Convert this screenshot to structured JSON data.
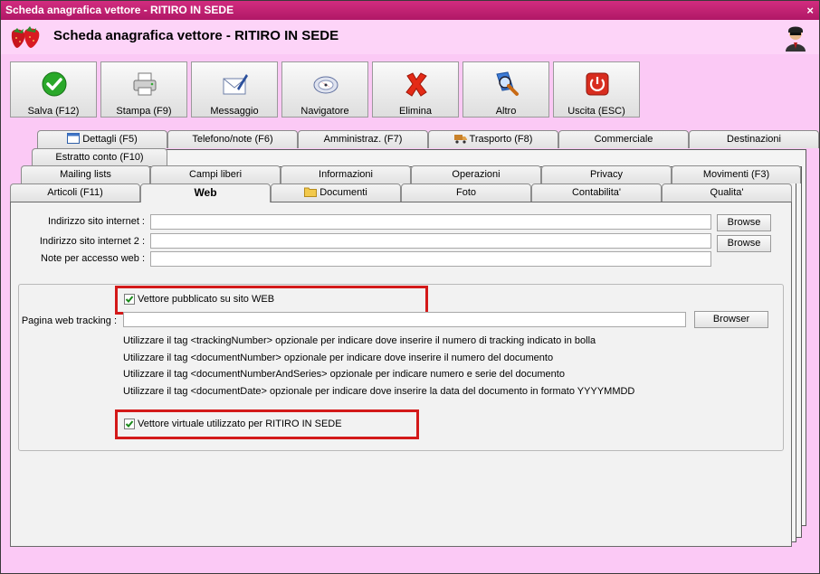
{
  "window": {
    "title": "Scheda anagrafica vettore - RITIRO IN SEDE",
    "close_glyph": "×"
  },
  "header": {
    "title": "Scheda anagrafica vettore - RITIRO IN SEDE",
    "logo_icon": "strawberry-icon",
    "user_icon": "user-agent-icon"
  },
  "toolbar": {
    "buttons": [
      {
        "label": "Salva (F12)",
        "icon": "checkmark-icon"
      },
      {
        "label": "Stampa (F9)",
        "icon": "printer-icon"
      },
      {
        "label": "Messaggio",
        "icon": "envelope-icon"
      },
      {
        "label": "Navigatore",
        "icon": "compass-icon"
      },
      {
        "label": "Elimina",
        "icon": "delete-x-icon"
      },
      {
        "label": "Altro",
        "icon": "search-document-icon"
      },
      {
        "label": "Uscita (ESC)",
        "icon": "power-icon"
      }
    ]
  },
  "tabs": {
    "row1": [
      "Dettagli (F5)",
      "Telefono/note (F6)",
      "Amministraz. (F7)",
      "Trasporto (F8)",
      "Commerciale",
      "Destinazioni"
    ],
    "row2": [
      "Estratto conto (F10)"
    ],
    "row3": [
      "Mailing lists",
      "Campi liberi",
      "Informazioni",
      "Operazioni",
      "Privacy",
      "Movimenti (F3)"
    ],
    "row4": [
      "Articoli (F11)",
      "Web",
      "Documenti",
      "Foto",
      "Contabilita'",
      "Qualita'"
    ],
    "active": "Web"
  },
  "web": {
    "sito_label": "Indirizzo sito internet :",
    "sito_value": "",
    "sito2_label": "Indirizzo sito internet 2 :",
    "sito2_value": "",
    "note_label": "Note per accesso web :",
    "note_value": "",
    "browse_label": "Browse",
    "pubblicato_label": "Vettore pubblicato su sito WEB",
    "pubblicato_checked": true,
    "tracking_label": "Pagina web tracking :",
    "tracking_value": "",
    "browser_label": "Browser",
    "hints": [
      "Utilizzare il tag <trackingNumber> opzionale per indicare dove inserire il numero di tracking indicato in bolla",
      "Utilizzare il tag <documentNumber> opzionale per indicare dove inserire il numero del documento",
      "Utilizzare il tag <documentNumberAndSeries> opzionale per indicare numero e serie del documento",
      "Utilizzare il tag <documentDate> opzionale per indicare dove inserire la data del documento in formato YYYYMMDD"
    ],
    "virtuale_label": "Vettore virtuale utilizzato per RITIRO IN SEDE",
    "virtuale_checked": true
  },
  "colors": {
    "title_bar": "#c2226f",
    "background": "#fbc9f5",
    "highlight": "#d31919",
    "check": "#1a8a1a"
  }
}
